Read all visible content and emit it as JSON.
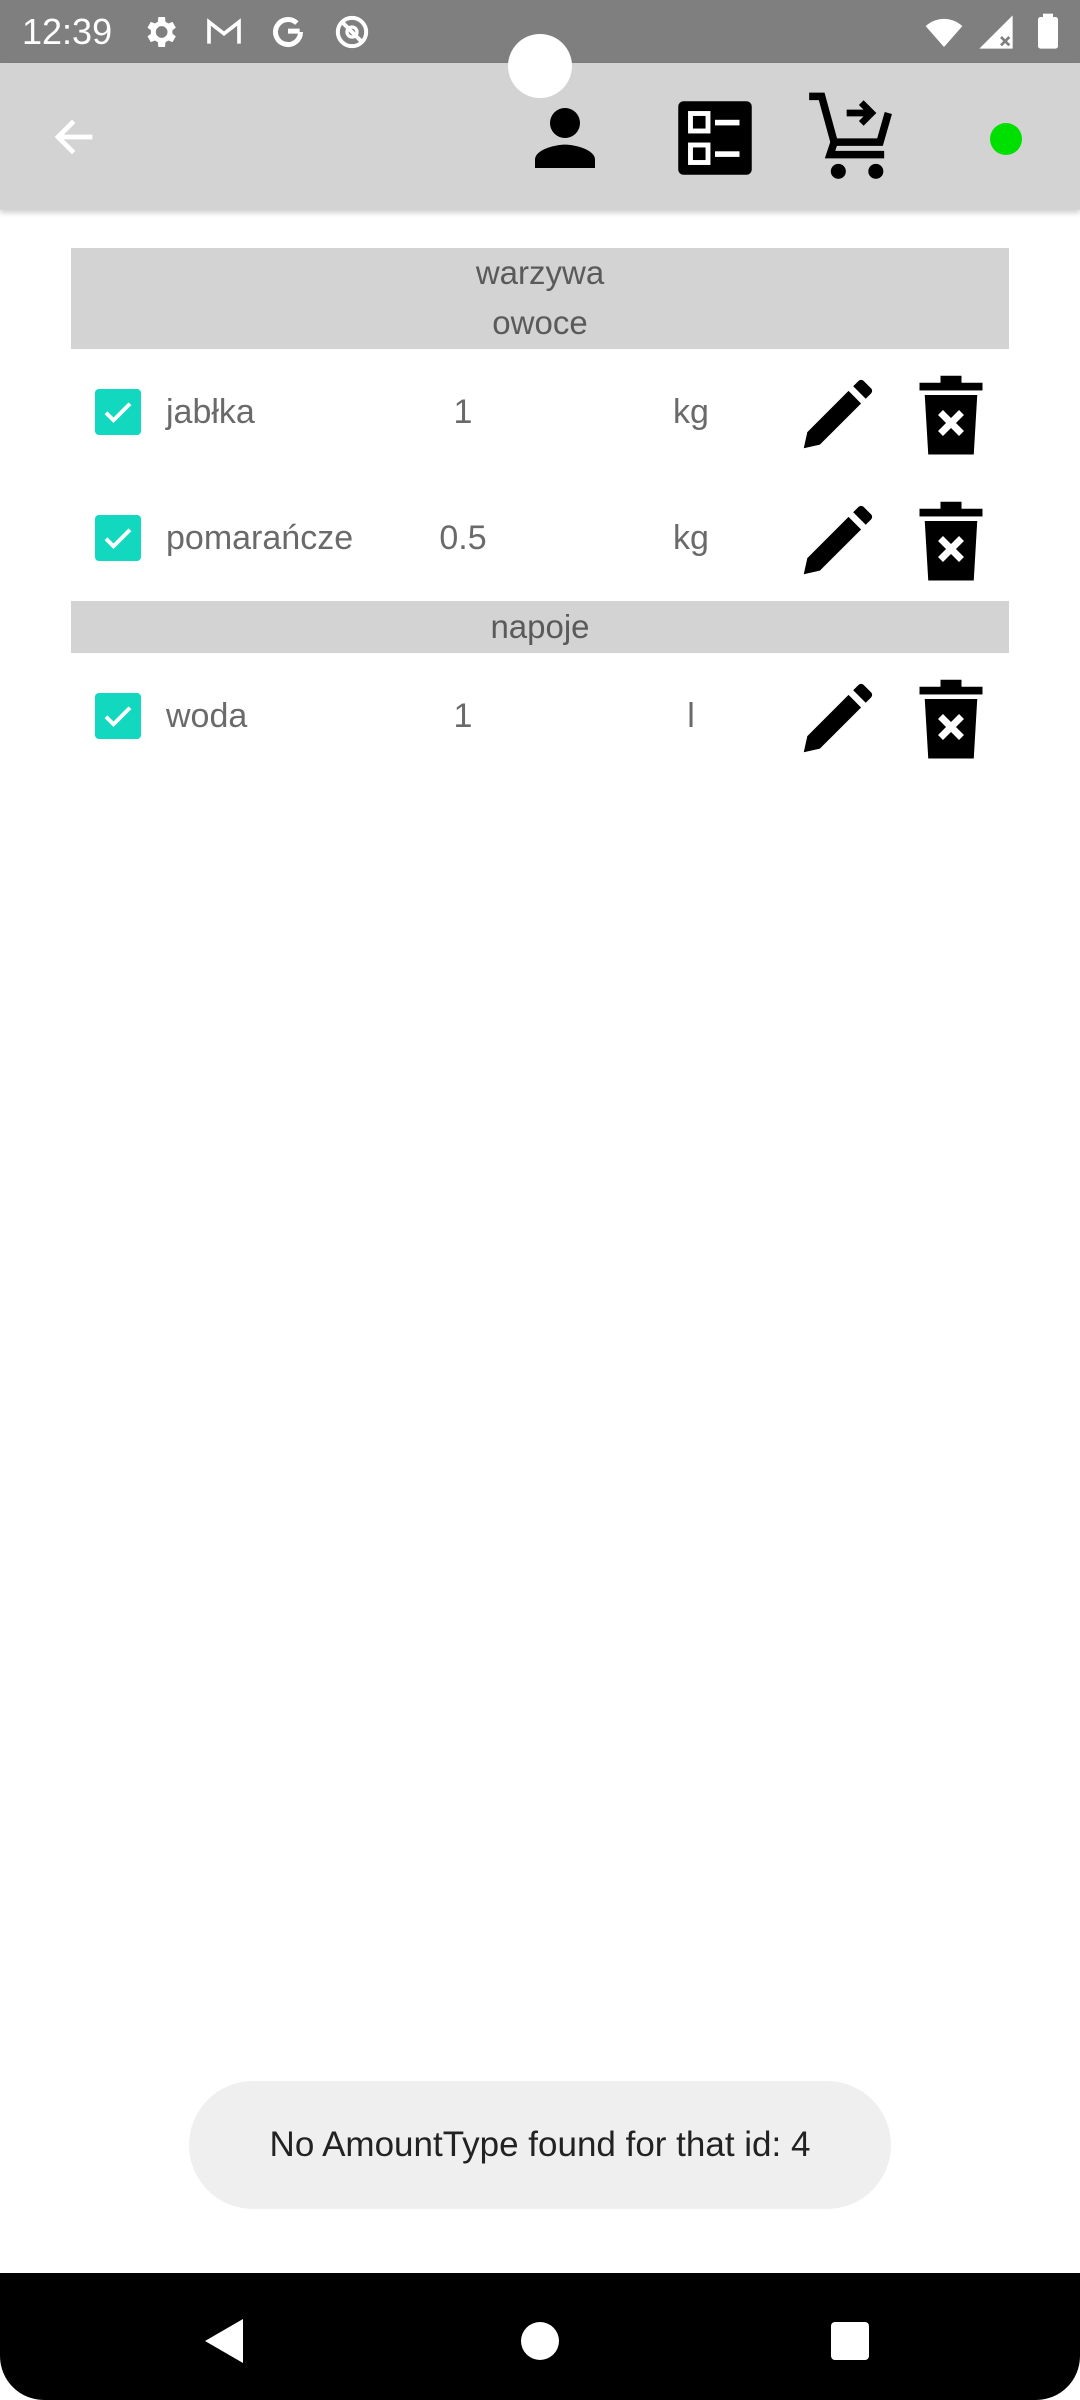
{
  "status_bar": {
    "time": "12:39",
    "left_icons": [
      "gear-icon",
      "gmail-icon",
      "google-icon",
      "no-sync-icon"
    ],
    "right_icons": [
      "wifi-icon",
      "signal-icon",
      "battery-icon"
    ]
  },
  "app_bar": {
    "back_icon": "arrow-left-icon",
    "actions": [
      "person-icon",
      "list-icon",
      "cart-add-icon"
    ],
    "online_indicator_color": "#00e000"
  },
  "groups": [
    {
      "header_lines": [
        "warzywa",
        "owoce"
      ],
      "items": [
        {
          "name": "jabłka",
          "amount": "1",
          "unit": "kg",
          "checked": true
        },
        {
          "name": "pomarańcze",
          "amount": "0.5",
          "unit": "kg",
          "checked": true
        }
      ]
    },
    {
      "header_lines": [
        "napoje"
      ],
      "items": [
        {
          "name": "woda",
          "amount": "1",
          "unit": "l",
          "checked": true
        }
      ]
    }
  ],
  "toast": {
    "message": "No AmountType found for that id: 4"
  },
  "colors": {
    "status_bar": "#7f7f7f",
    "app_bar": "#d3d3d3",
    "checkbox": "#12d8c0",
    "toast_bg": "#efefef"
  }
}
